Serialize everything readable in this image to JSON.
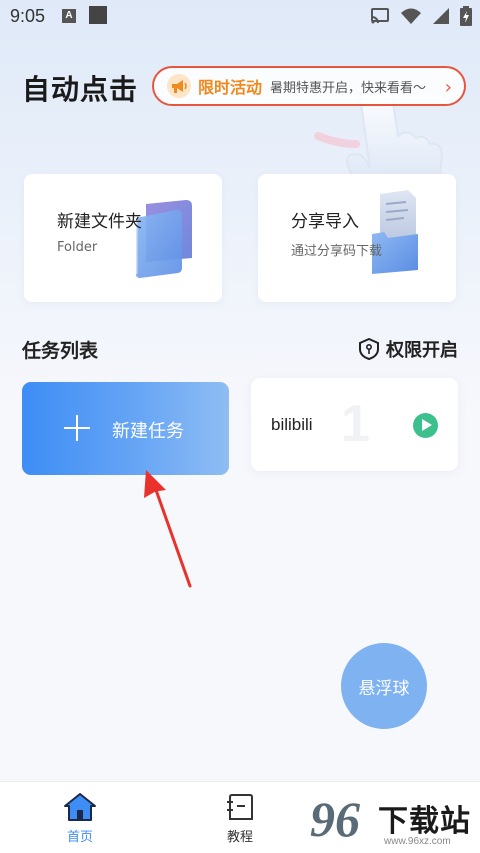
{
  "status_bar": {
    "time": "9:05",
    "a_badge": "A",
    "icons": [
      "cast-icon",
      "wifi-icon",
      "signal-icon",
      "battery-icon"
    ]
  },
  "header": {
    "title": "自动点击"
  },
  "promo": {
    "label": "限时活动",
    "text": "暑期特惠开启，快来看看～",
    "icon": "megaphone-icon",
    "accent": "#e8553f"
  },
  "cards": [
    {
      "title": "新建文件夹",
      "subtitle": "Folder",
      "icon": "folder-icon"
    },
    {
      "title": "分享导入",
      "subtitle": "通过分享码下载",
      "icon": "document-import-icon"
    }
  ],
  "tasks_section": {
    "title": "任务列表",
    "permission_label": "权限开启",
    "permission_icon": "shield-icon"
  },
  "new_task": {
    "label": "新建任务"
  },
  "task_items": [
    {
      "name": "bilibili",
      "number": "1"
    }
  ],
  "float_ball": {
    "label": "悬浮球"
  },
  "bottom_nav": {
    "items": [
      {
        "label": "首页",
        "icon": "home-icon",
        "active": true
      },
      {
        "label": "教程",
        "icon": "tutorial-icon",
        "active": false
      }
    ]
  },
  "watermark": {
    "number": "96",
    "text": "下载站",
    "url": "www.96xz.com"
  },
  "colors": {
    "primary": "#3d8df5",
    "promo_label": "#f08a1f",
    "play": "#3cc08e",
    "arrow": "#e8322b"
  }
}
